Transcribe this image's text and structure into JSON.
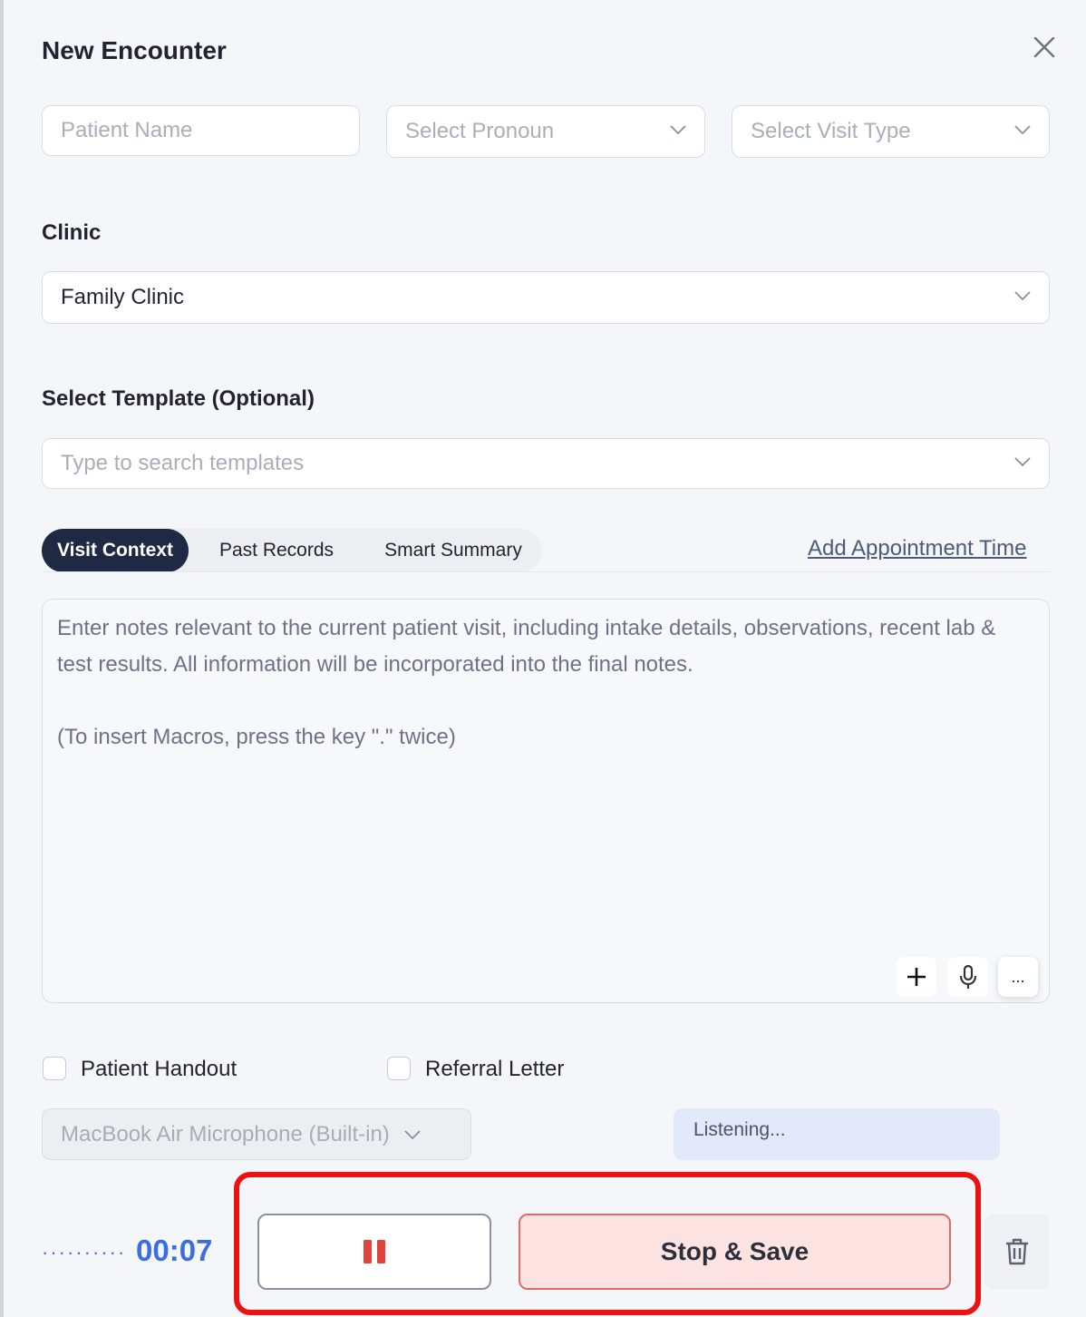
{
  "dialog": {
    "title": "New Encounter"
  },
  "patient": {
    "name_placeholder": "Patient Name",
    "pronoun_placeholder": "Select Pronoun",
    "visit_type_placeholder": "Select Visit Type"
  },
  "clinic": {
    "label": "Clinic",
    "value": "Family Clinic"
  },
  "template": {
    "label": "Select Template (Optional)",
    "placeholder": "Type to search templates"
  },
  "tabs": [
    {
      "label": "Visit Context",
      "active": true
    },
    {
      "label": "Past Records",
      "active": false
    },
    {
      "label": "Smart Summary",
      "active": false
    }
  ],
  "add_appointment_link": "Add Appointment Time",
  "notes": {
    "placeholder": "Enter notes relevant to the current patient visit, including intake details, observations, recent lab & test results. All information will be incorporated into the final notes.\n\n(To insert Macros, press the key \".\" twice)",
    "more_label": "..."
  },
  "options": {
    "patient_handout": {
      "label": "Patient Handout",
      "checked": false
    },
    "referral_letter": {
      "label": "Referral Letter",
      "checked": false
    }
  },
  "microphone": {
    "selected": "MacBook Air Microphone (Built-in)"
  },
  "status": {
    "listening": "Listening..."
  },
  "recording": {
    "level_indicator": "··········",
    "timer": "00:07",
    "stop_label": "Stop & Save"
  },
  "icons": {
    "close": "close-icon",
    "chevron": "chevron-down-icon",
    "plus": "plus-icon",
    "mic": "microphone-icon",
    "pause": "pause-icon",
    "trash": "trash-icon"
  },
  "colors": {
    "accent_blue": "#3b6fe0",
    "tab_active": "#1e2a44",
    "stop_bg": "#fde2e2",
    "stop_border": "#e06b66",
    "pause_icon": "#e0433b",
    "highlight": "#ee1111",
    "listening_bg": "#e3e9fb"
  }
}
